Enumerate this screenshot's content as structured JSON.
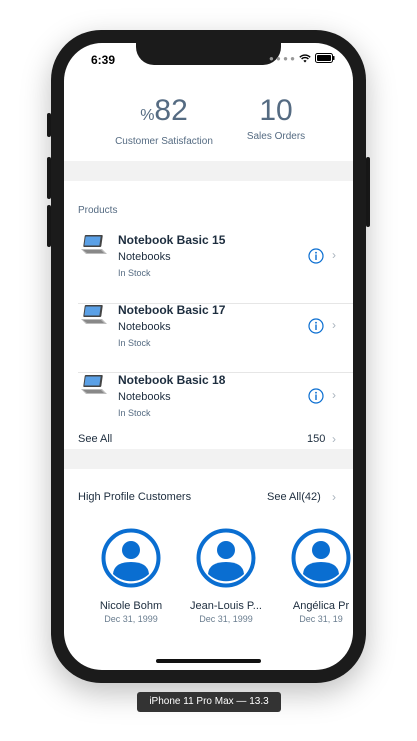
{
  "status_bar": {
    "time": "6:39",
    "icons": [
      "signal-dots-icon",
      "wifi-icon",
      "battery-icon"
    ]
  },
  "kpis": [
    {
      "prefix": "%",
      "value": "82",
      "label": "Customer Satisfaction"
    },
    {
      "prefix": "",
      "value": "10",
      "label": "Sales Orders"
    }
  ],
  "products": {
    "header": "Products",
    "items": [
      {
        "title": "Notebook Basic 15",
        "category": "Notebooks",
        "status": "In Stock",
        "icon": "laptop-icon"
      },
      {
        "title": "Notebook Basic 17",
        "category": "Notebooks",
        "status": "In Stock",
        "icon": "laptop-icon"
      },
      {
        "title": "Notebook Basic 18",
        "category": "Notebooks",
        "status": "In Stock",
        "icon": "laptop-icon"
      }
    ],
    "see_all_label": "See All",
    "see_all_count": "150"
  },
  "customers": {
    "header": "High Profile Customers",
    "see_all_label": "See All(42)",
    "items": [
      {
        "name": "Nicole Bohm",
        "date": "Dec 31, 1999"
      },
      {
        "name": "Jean-Louis P...",
        "date": "Dec 31, 1999"
      },
      {
        "name": "Angélica Pr",
        "date": "Dec 31, 19"
      }
    ]
  },
  "device_caption": "iPhone 11 Pro Max — 13.3",
  "colors": {
    "accent": "#0a6ed1",
    "text": "#1d2d3e",
    "muted": "#556b82",
    "band": "#f2f2f2"
  }
}
